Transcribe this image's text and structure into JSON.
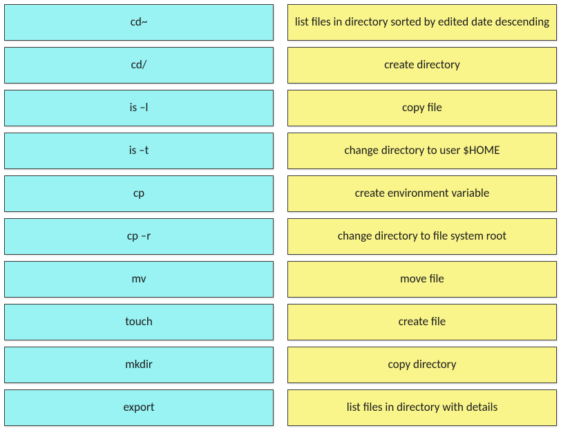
{
  "left": {
    "items": [
      {
        "label": "cd~"
      },
      {
        "label": "cd/"
      },
      {
        "label": "is –l"
      },
      {
        "label": "is –t"
      },
      {
        "label": "cp"
      },
      {
        "label": "cp –r"
      },
      {
        "label": "mv"
      },
      {
        "label": "touch"
      },
      {
        "label": "mkdir"
      },
      {
        "label": "export"
      }
    ]
  },
  "right": {
    "items": [
      {
        "label": "list files in directory sorted by edited date descending"
      },
      {
        "label": "create directory"
      },
      {
        "label": "copy file"
      },
      {
        "label": "change directory to user $HOME"
      },
      {
        "label": "create environment variable"
      },
      {
        "label": "change directory to file system root"
      },
      {
        "label": "move file"
      },
      {
        "label": "create file"
      },
      {
        "label": "copy directory"
      },
      {
        "label": "list files in directory with details"
      }
    ]
  }
}
